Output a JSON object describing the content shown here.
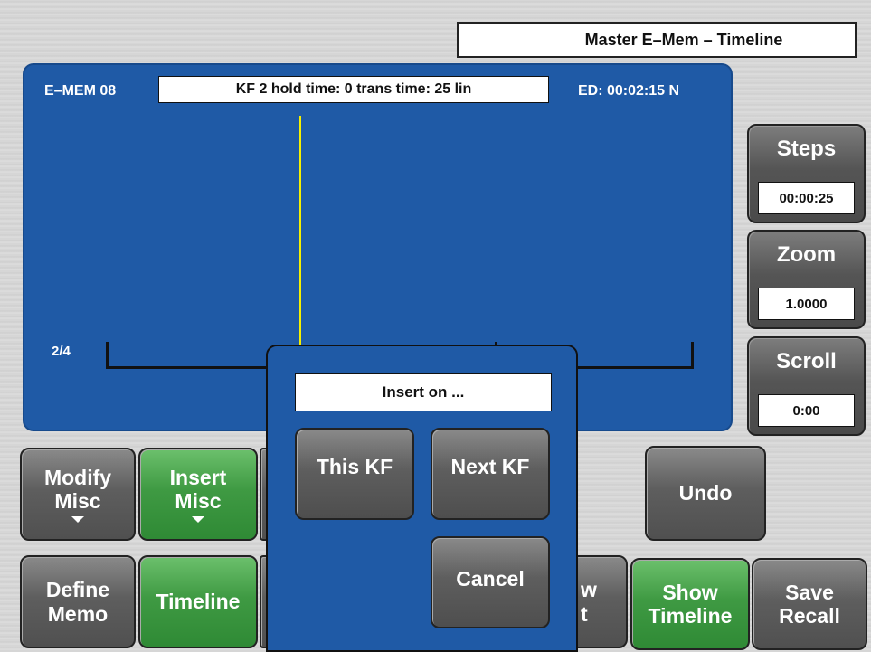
{
  "header": {
    "title": "Master E–Mem – Timeline"
  },
  "timeline": {
    "emem_label": "E–MEM 08",
    "kf_info": "KF 2 hold time: 0 trans time: 25 lin",
    "ed_label": "ED: 00:02:15 N",
    "track_label": "2/4"
  },
  "side": {
    "steps": {
      "label": "Steps",
      "value": "00:00:25"
    },
    "zoom": {
      "label": "Zoom",
      "value": "1.0000"
    },
    "scroll": {
      "label": "Scroll",
      "value": "0:00"
    }
  },
  "buttons": {
    "modify_misc": [
      "Modify",
      "Misc"
    ],
    "insert_misc": [
      "Insert",
      "Misc"
    ],
    "define_memo": [
      "Define",
      "Memo"
    ],
    "timeline": "Timeline",
    "undo": "Undo",
    "hidden_partial": [
      "w",
      "t"
    ],
    "show_timeline": [
      "Show",
      "Timeline"
    ],
    "save_recall": [
      "Save",
      "Recall"
    ]
  },
  "dialog": {
    "title": "Insert on ...",
    "this_kf": "This KF",
    "next_kf": "Next KF",
    "cancel": "Cancel"
  },
  "colors": {
    "panel_blue": "#1f5aa6",
    "active_green": "#3f9a43",
    "button_gray": "#5e5e5e",
    "cursor_yellow": "#f5f000"
  }
}
